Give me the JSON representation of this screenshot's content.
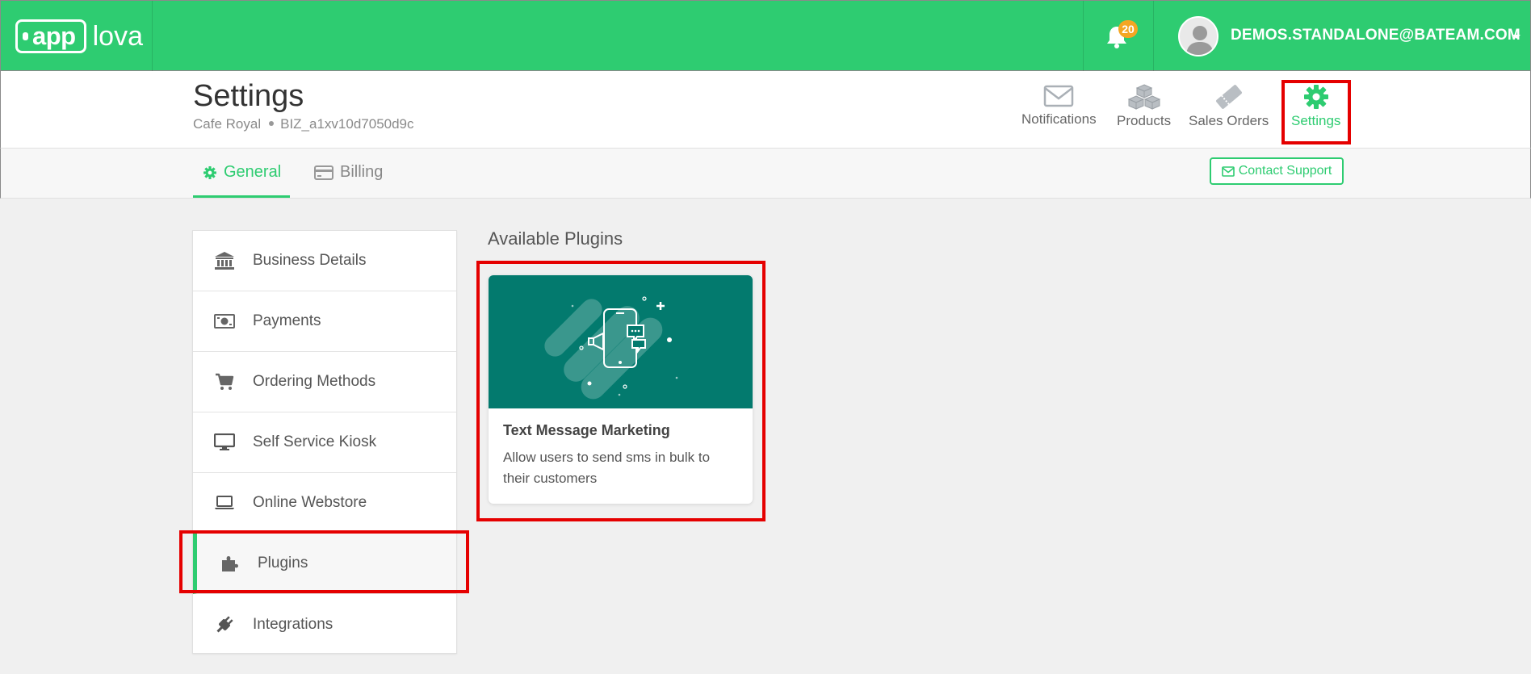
{
  "app": {
    "logo_left": "app",
    "logo_right": "lova"
  },
  "topbar": {
    "notification_count": "20",
    "user_email": "DEMOS.STANDALONE@BATEAM.COM"
  },
  "header": {
    "title": "Settings",
    "business_name": "Cafe Royal",
    "business_id": "BIZ_a1xv10d7050d9c",
    "nav": [
      {
        "label": "Notifications",
        "icon": "envelope-icon"
      },
      {
        "label": "Products",
        "icon": "cubes-icon"
      },
      {
        "label": "Sales Orders",
        "icon": "ticket-icon"
      },
      {
        "label": "Settings",
        "icon": "gear-icon",
        "active": true
      }
    ]
  },
  "tabs": {
    "items": [
      {
        "label": "General",
        "icon": "gear-icon",
        "active": true
      },
      {
        "label": "Billing",
        "icon": "credit-card-icon"
      }
    ],
    "support_label": "Contact Support"
  },
  "sidebar": {
    "items": [
      {
        "label": "Business Details",
        "icon": "bank-icon"
      },
      {
        "label": "Payments",
        "icon": "money-icon"
      },
      {
        "label": "Ordering Methods",
        "icon": "cart-icon"
      },
      {
        "label": "Self Service Kiosk",
        "icon": "desktop-icon"
      },
      {
        "label": "Online Webstore",
        "icon": "laptop-icon"
      },
      {
        "label": "Plugins",
        "icon": "puzzle-icon",
        "active": true
      },
      {
        "label": "Integrations",
        "icon": "plug-icon"
      }
    ]
  },
  "plugins": {
    "section_title": "Available Plugins",
    "cards": [
      {
        "title": "Text Message Marketing",
        "description": "Allow users to send sms in bulk to their customers"
      }
    ]
  },
  "colors": {
    "brand_green": "#2ecc71",
    "card_teal": "#037a6e",
    "annotation_red": "#e50000",
    "badge_orange": "#f5a623"
  }
}
